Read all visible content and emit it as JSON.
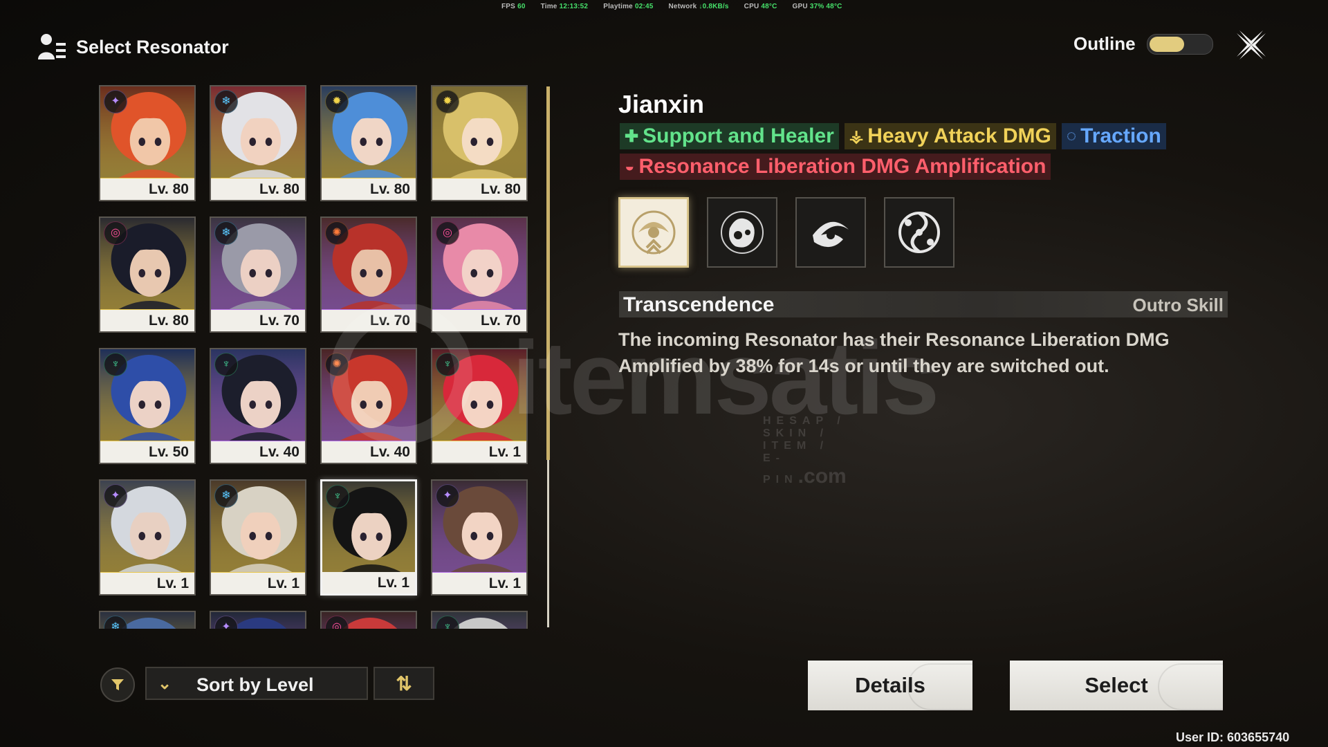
{
  "status_bar": {
    "fps_label": "FPS",
    "fps": "60",
    "time_label": "Time",
    "time": "12:13:52",
    "playtime_label": "Playtime",
    "playtime": "02:45",
    "network_label": "Network",
    "network": "↓0.8KB/s",
    "cpu_label": "CPU",
    "cpu": "48°C",
    "gpu_label": "GPU",
    "gpu": "37% 48°C"
  },
  "header": {
    "title": "Select Resonator"
  },
  "outline": {
    "label": "Outline",
    "enabled": true
  },
  "colors": {
    "accent_gold": "#e2cc7f",
    "rarity_5": "#e8c64a",
    "rarity_4": "#b26be6",
    "tag_green": "#62e38b",
    "tag_yellow": "#f1d259",
    "tag_blue": "#66a8ff",
    "tag_red": "#ff5f6c"
  },
  "roster": [
    {
      "level": "Lv. 80",
      "element": "havoc-wind-icon",
      "glyph": "✦",
      "elem_color": "#b68cff",
      "rarity": 5,
      "hair": "#e0542a",
      "skin": "#f1c7a8",
      "bg": "#6a2d1d",
      "selected": false
    },
    {
      "level": "Lv. 80",
      "element": "glacio-icon",
      "glyph": "❄",
      "elem_color": "#5ac8ff",
      "rarity": 5,
      "hair": "#e2e2e6",
      "skin": "#f1d2c0",
      "bg": "#7a2a32",
      "selected": false
    },
    {
      "level": "Lv. 80",
      "element": "spectro-icon",
      "glyph": "✹",
      "elem_color": "#f3d44a",
      "rarity": 5,
      "hair": "#4e8ed8",
      "skin": "#f0d6c6",
      "bg": "#283c5e",
      "selected": false
    },
    {
      "level": "Lv. 80",
      "element": "spectro-icon",
      "glyph": "✹",
      "elem_color": "#f3d44a",
      "rarity": 5,
      "hair": "#d8c06a",
      "skin": "#f4dcc4",
      "bg": "#7a6a34",
      "selected": false
    },
    {
      "level": "Lv. 80",
      "element": "havoc-icon",
      "glyph": "◎",
      "elem_color": "#ff4e9a",
      "rarity": 5,
      "hair": "#1a1c2a",
      "skin": "#e8c8b0",
      "bg": "#2a2a30",
      "selected": false
    },
    {
      "level": "Lv. 70",
      "element": "glacio-icon",
      "glyph": "❄",
      "elem_color": "#5ac8ff",
      "rarity": 4,
      "hair": "#9a9aa8",
      "skin": "#ecd0c4",
      "bg": "#3a3440",
      "selected": false
    },
    {
      "level": "Lv. 70",
      "element": "fusion-icon",
      "glyph": "✺",
      "elem_color": "#ff7b3a",
      "rarity": 4,
      "hair": "#b8322a",
      "skin": "#e8c0a6",
      "bg": "#4a2a2a",
      "selected": false
    },
    {
      "level": "Lv. 70",
      "element": "havoc-icon",
      "glyph": "◎",
      "elem_color": "#ff4e9a",
      "rarity": 4,
      "hair": "#e88aa8",
      "skin": "#f2d2c8",
      "bg": "#5a3048",
      "selected": false
    },
    {
      "level": "Lv. 50",
      "element": "aero-icon",
      "glyph": "♆",
      "elem_color": "#46e0a0",
      "rarity": 5,
      "hair": "#2e4ea8",
      "skin": "#ecd2c6",
      "bg": "#1e2e58",
      "selected": false
    },
    {
      "level": "Lv. 40",
      "element": "aero-icon",
      "glyph": "♆",
      "elem_color": "#46e0a0",
      "rarity": 4,
      "hair": "#1c1e2c",
      "skin": "#ecd2c6",
      "bg": "#2a3460",
      "selected": false
    },
    {
      "level": "Lv. 40",
      "element": "fusion-icon",
      "glyph": "✺",
      "elem_color": "#ff7b3a",
      "rarity": 4,
      "hair": "#c8372c",
      "skin": "#f0ccb4",
      "bg": "#4a2424",
      "selected": false
    },
    {
      "level": "Lv. 1",
      "element": "aero-icon",
      "glyph": "♆",
      "elem_color": "#46e0a0",
      "rarity": 5,
      "hair": "#d8283a",
      "skin": "#f4d4c4",
      "bg": "#5a1e28",
      "selected": false
    },
    {
      "level": "Lv. 1",
      "element": "havoc-wind-icon",
      "glyph": "✦",
      "elem_color": "#b68cff",
      "rarity": 5,
      "hair": "#d4d8de",
      "skin": "#e8d0c2",
      "bg": "#3c4250",
      "selected": false
    },
    {
      "level": "Lv. 1",
      "element": "glacio-icon",
      "glyph": "❄",
      "elem_color": "#5ac8ff",
      "rarity": 5,
      "hair": "#d8d2c4",
      "skin": "#f0d0bc",
      "bg": "#4a3a2a",
      "selected": false
    },
    {
      "level": "Lv. 1",
      "element": "aero-icon",
      "glyph": "♆",
      "elem_color": "#46e0a0",
      "rarity": 5,
      "hair": "#141414",
      "skin": "#ecd2c2",
      "bg": "#3a3a34",
      "selected": true
    },
    {
      "level": "Lv. 1",
      "element": "havoc-wind-icon",
      "glyph": "✦",
      "elem_color": "#b68cff",
      "rarity": 4,
      "hair": "#6a4a3a",
      "skin": "#f2d4c4",
      "bg": "#3a2c34",
      "selected": false
    },
    {
      "level": "",
      "element": "glacio-icon",
      "glyph": "❄",
      "elem_color": "#5ac8ff",
      "rarity": 5,
      "hair": "#4a6aa0",
      "skin": "#ecd2c6",
      "bg": "#2a3040",
      "selected": false
    },
    {
      "level": "",
      "element": "havoc-wind-icon",
      "glyph": "✦",
      "elem_color": "#b68cff",
      "rarity": 4,
      "hair": "#2a3a80",
      "skin": "#ecd2c6",
      "bg": "#222838",
      "selected": false
    },
    {
      "level": "",
      "element": "havoc-icon",
      "glyph": "◎",
      "elem_color": "#ff4e9a",
      "rarity": 4,
      "hair": "#c83a3a",
      "skin": "#ecd2c6",
      "bg": "#3a2424",
      "selected": false
    },
    {
      "level": "",
      "element": "aero-icon",
      "glyph": "♆",
      "elem_color": "#46e0a0",
      "rarity": 4,
      "hair": "#c8c8c8",
      "skin": "#ecd2c6",
      "bg": "#30343a",
      "selected": false
    }
  ],
  "character": {
    "name": "Jianxin",
    "tags": [
      {
        "label": "Support and Healer",
        "icon": "✚",
        "color": "green",
        "icon_name": "support-healer-icon"
      },
      {
        "label": "Heavy Attack DMG",
        "icon": "⚶",
        "color": "yellow",
        "icon_name": "heavy-attack-icon"
      },
      {
        "label": "Traction",
        "icon": "◌",
        "color": "blue",
        "icon_name": "traction-icon"
      },
      {
        "label": "Resonance Liberation DMG Amplification",
        "icon": "◒",
        "color": "red",
        "icon_name": "liberation-amplify-icon"
      }
    ],
    "skills": [
      {
        "icon_name": "outro-skill-icon",
        "active": true
      },
      {
        "icon_name": "fist-skill-icon",
        "active": false
      },
      {
        "icon_name": "whirlwind-skill-icon",
        "active": false
      },
      {
        "icon_name": "vortex-skill-icon",
        "active": false
      }
    ],
    "skill_name": "Transcendence",
    "skill_type": "Outro Skill",
    "skill_desc": "The incoming Resonator has their Resonance Liberation DMG Amplified by 38% for 14s or until they are switched out."
  },
  "sort": {
    "label": "Sort by Level",
    "order_icon": "⇅"
  },
  "buttons": {
    "details": "Details",
    "select": "Select"
  },
  "user_id": "User ID: 603655740",
  "watermark": {
    "text": "itemsatis",
    "sub": "HESAP / SKIN / ITEM / E-PIN",
    "dotcom": ".com"
  }
}
